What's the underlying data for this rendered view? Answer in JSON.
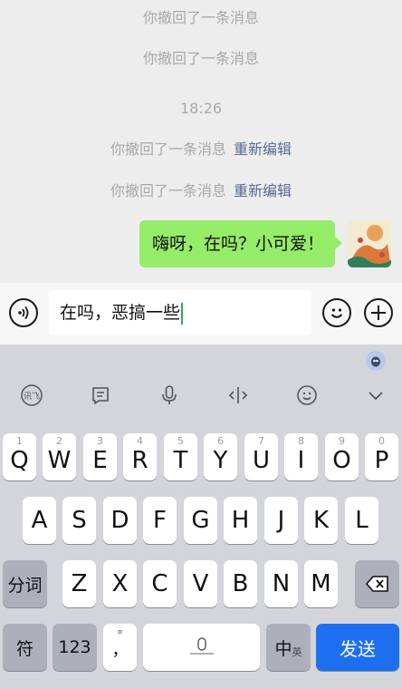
{
  "chat": {
    "sys1": "你撤回了一条消息",
    "sys2": "你撤回了一条消息",
    "time": "18:26",
    "sys3": "你撤回了一条消息",
    "sys3_link": "重新编辑",
    "sys4": "你撤回了一条消息",
    "sys4_link": "重新编辑",
    "bubble": "嗨呀，在吗？小可爱！"
  },
  "input": {
    "value": "在吗，恶搞一些"
  },
  "keyboard": {
    "row1": [
      {
        "letter": "Q",
        "num": "1"
      },
      {
        "letter": "W",
        "num": "2"
      },
      {
        "letter": "E",
        "num": "3"
      },
      {
        "letter": "R",
        "num": "4"
      },
      {
        "letter": "T",
        "num": "5"
      },
      {
        "letter": "Y",
        "num": "6"
      },
      {
        "letter": "U",
        "num": "7"
      },
      {
        "letter": "I",
        "num": "8"
      },
      {
        "letter": "O",
        "num": "9"
      },
      {
        "letter": "P",
        "num": "0"
      }
    ],
    "row2": [
      "A",
      "S",
      "D",
      "F",
      "G",
      "H",
      "J",
      "K",
      "L"
    ],
    "row3": [
      "Z",
      "X",
      "C",
      "V",
      "B",
      "N",
      "M"
    ],
    "fenci": "分词",
    "fu": "符",
    "num123": "123",
    "punct": "，",
    "zhong": "中",
    "ying": "英",
    "send": "发送"
  },
  "colors": {
    "bubble": "#95ec69",
    "link": "#576b95",
    "send": "#1e6ff0",
    "caret": "#2db34a"
  }
}
